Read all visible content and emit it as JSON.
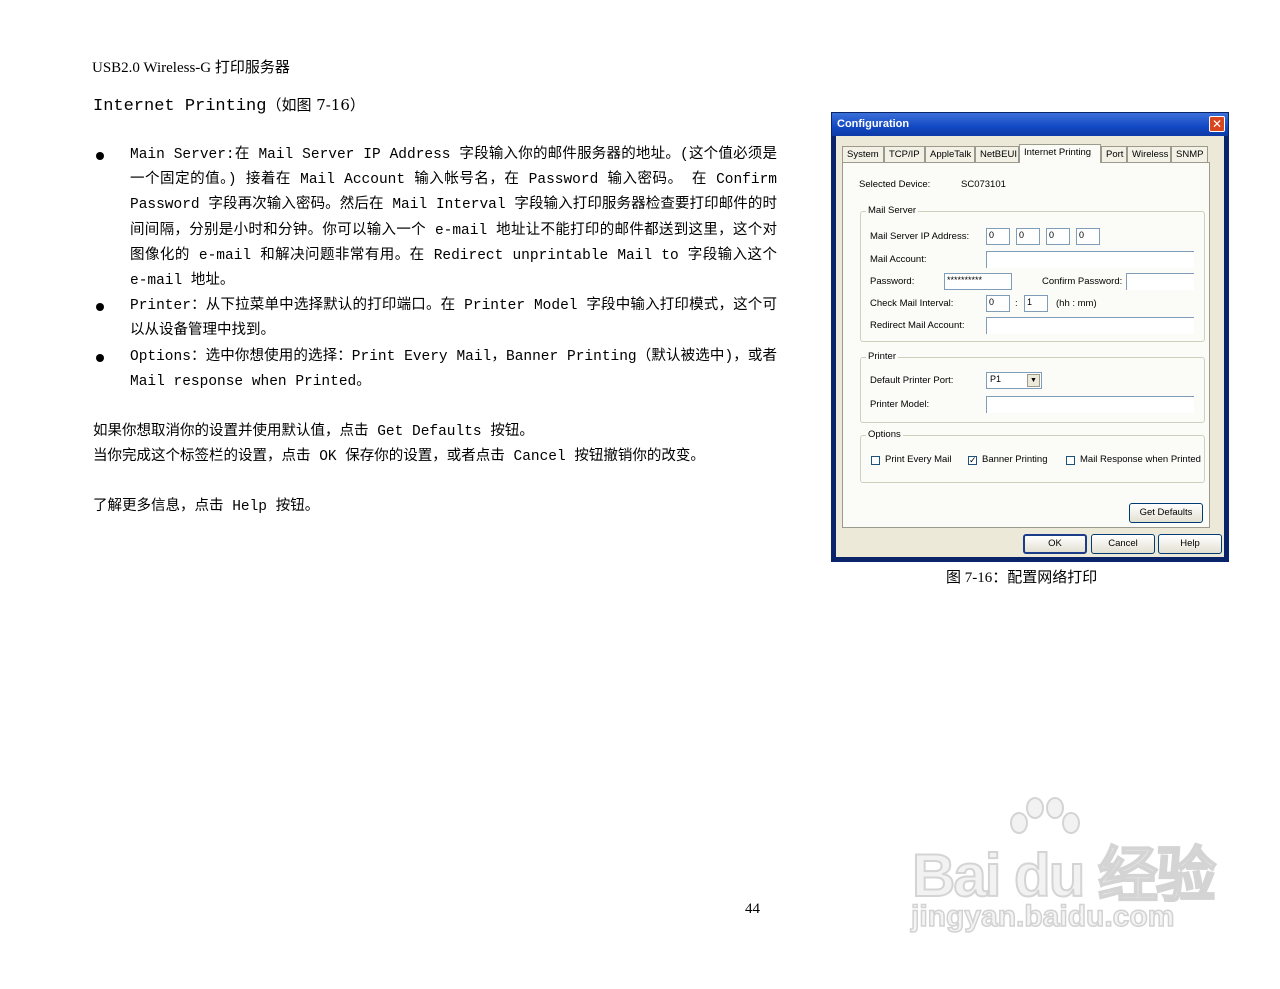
{
  "header": "USB2.0 Wireless-G 打印服务器",
  "section": {
    "title": "Internet Printing",
    "figure_ref": "（如图 7-16）"
  },
  "bullets": [
    "Main Server:在 Mail Server IP Address 字段输入你的邮件服务器的地址。(这个值必须是一个固定的值。) 接着在 Mail Account 输入帐号名，在 Password 输入密码。 在 Confirm Password 字段再次输入密码。然后在 Mail Interval 字段输入打印服务器检查要打印邮件的时间间隔，分别是小时和分钟。你可以输入一个 e-mail 地址让不能打印的邮件都送到这里，这个对图像化的 e-mail 和解决问题非常有用。在 Redirect unprintable Mail to 字段输入这个 e-mail 地址。",
    "Printer：从下拉菜单中选择默认的打印端口。在 Printer Model 字段中输入打印模式，这个可以从设备管理中找到。",
    "Options：选中你想使用的选择：Print Every Mail，Banner Printing（默认被选中)，或者 Mail response when Printed。"
  ],
  "paragraphs": [
    "如果你想取消你的设置并使用默认值，点击 Get Defaults 按钮。",
    "当你完成这个标签栏的设置，点击 OK 保存你的设置，或者点击 Cancel 按钮撤销你的改变。",
    "了解更多信息，点击 Help 按钮。"
  ],
  "page_number": "44",
  "dialog": {
    "title": "Configuration",
    "tabs": [
      "System",
      "TCP/IP",
      "AppleTalk",
      "NetBEUI",
      "Internet Printing",
      "Port",
      "Wireless",
      "SNMP"
    ],
    "active_tab": "Internet Printing",
    "selected_device_label": "Selected Device:",
    "selected_device_value": "SC073101",
    "mail_server": {
      "group_label": "Mail Server",
      "ip_label": "Mail Server IP Address:",
      "ip_octets": [
        "0",
        "0",
        "0",
        "0"
      ],
      "account_label": "Mail Account:",
      "password_label": "Password:",
      "password_value": "**********",
      "confirm_label": "Confirm Password:",
      "interval_label": "Check Mail Interval:",
      "interval_hours": "0",
      "interval_minutes": "1",
      "interval_unit": "(hh : mm)",
      "interval_sep": ":",
      "redirect_label": "Redirect Mail Account:"
    },
    "printer": {
      "group_label": "Printer",
      "port_label": "Default Printer Port:",
      "port_value": "P1",
      "model_label": "Printer Model:"
    },
    "options": {
      "group_label": "Options",
      "items": [
        {
          "label": "Print Every Mail",
          "checked": false,
          "mark": ""
        },
        {
          "label": "Banner Printing",
          "checked": true,
          "mark": "✓"
        },
        {
          "label": "Mail Response when Printed",
          "checked": false,
          "mark": ""
        }
      ]
    },
    "buttons": {
      "get_defaults": "Get Defaults",
      "ok": "OK",
      "cancel": "Cancel",
      "help": "Help"
    },
    "close_glyph": "✕"
  },
  "figure_caption": "图 7-16：配置网络打印",
  "watermark": {
    "brand": "Bai du 经验",
    "url": "jingyan.baidu.com"
  }
}
